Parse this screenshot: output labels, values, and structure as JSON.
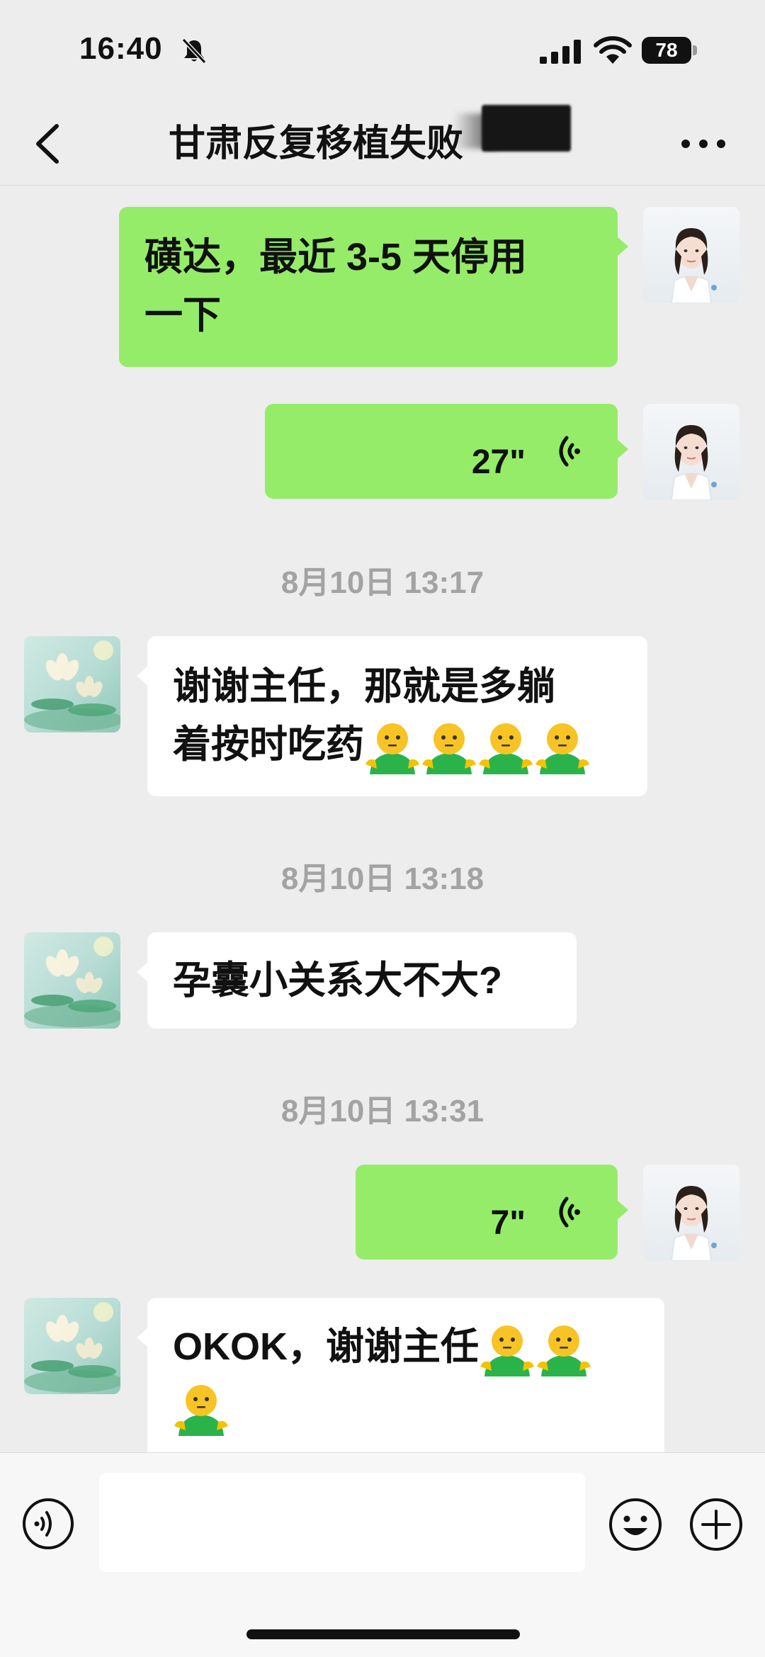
{
  "status_bar": {
    "time": "16:40",
    "battery": "78"
  },
  "header": {
    "title": "甘肃反复移植失败"
  },
  "messages": [
    {
      "type": "text",
      "side": "out",
      "line1": "磺达，最近 3-5 天停用",
      "line2": "一下"
    },
    {
      "type": "voice",
      "side": "out",
      "duration": "27\""
    },
    {
      "type": "timestamp",
      "text": "8月10日 13:17"
    },
    {
      "type": "text",
      "side": "in",
      "line1": "谢谢主任，那就是多躺",
      "line2": "着按时吃药"
    },
    {
      "type": "timestamp",
      "text": "8月10日 13:18"
    },
    {
      "type": "text",
      "side": "in",
      "line1": "孕囊小关系大不大?"
    },
    {
      "type": "timestamp",
      "text": "8月10日 13:31"
    },
    {
      "type": "voice",
      "side": "out",
      "duration": "7\""
    },
    {
      "type": "text",
      "side": "in",
      "line1": "OKOK，谢谢主任"
    }
  ],
  "icons": [
    "bell-muted-icon",
    "signal-icon",
    "wifi-icon",
    "back-icon",
    "more-icon",
    "voice-wave-icon",
    "emoji-icon",
    "plus-icon"
  ],
  "colors": {
    "background": "#ededed",
    "outgoing_bubble": "#95ec69",
    "incoming_bubble": "#ffffff",
    "timestamp": "#a3a3a3"
  }
}
